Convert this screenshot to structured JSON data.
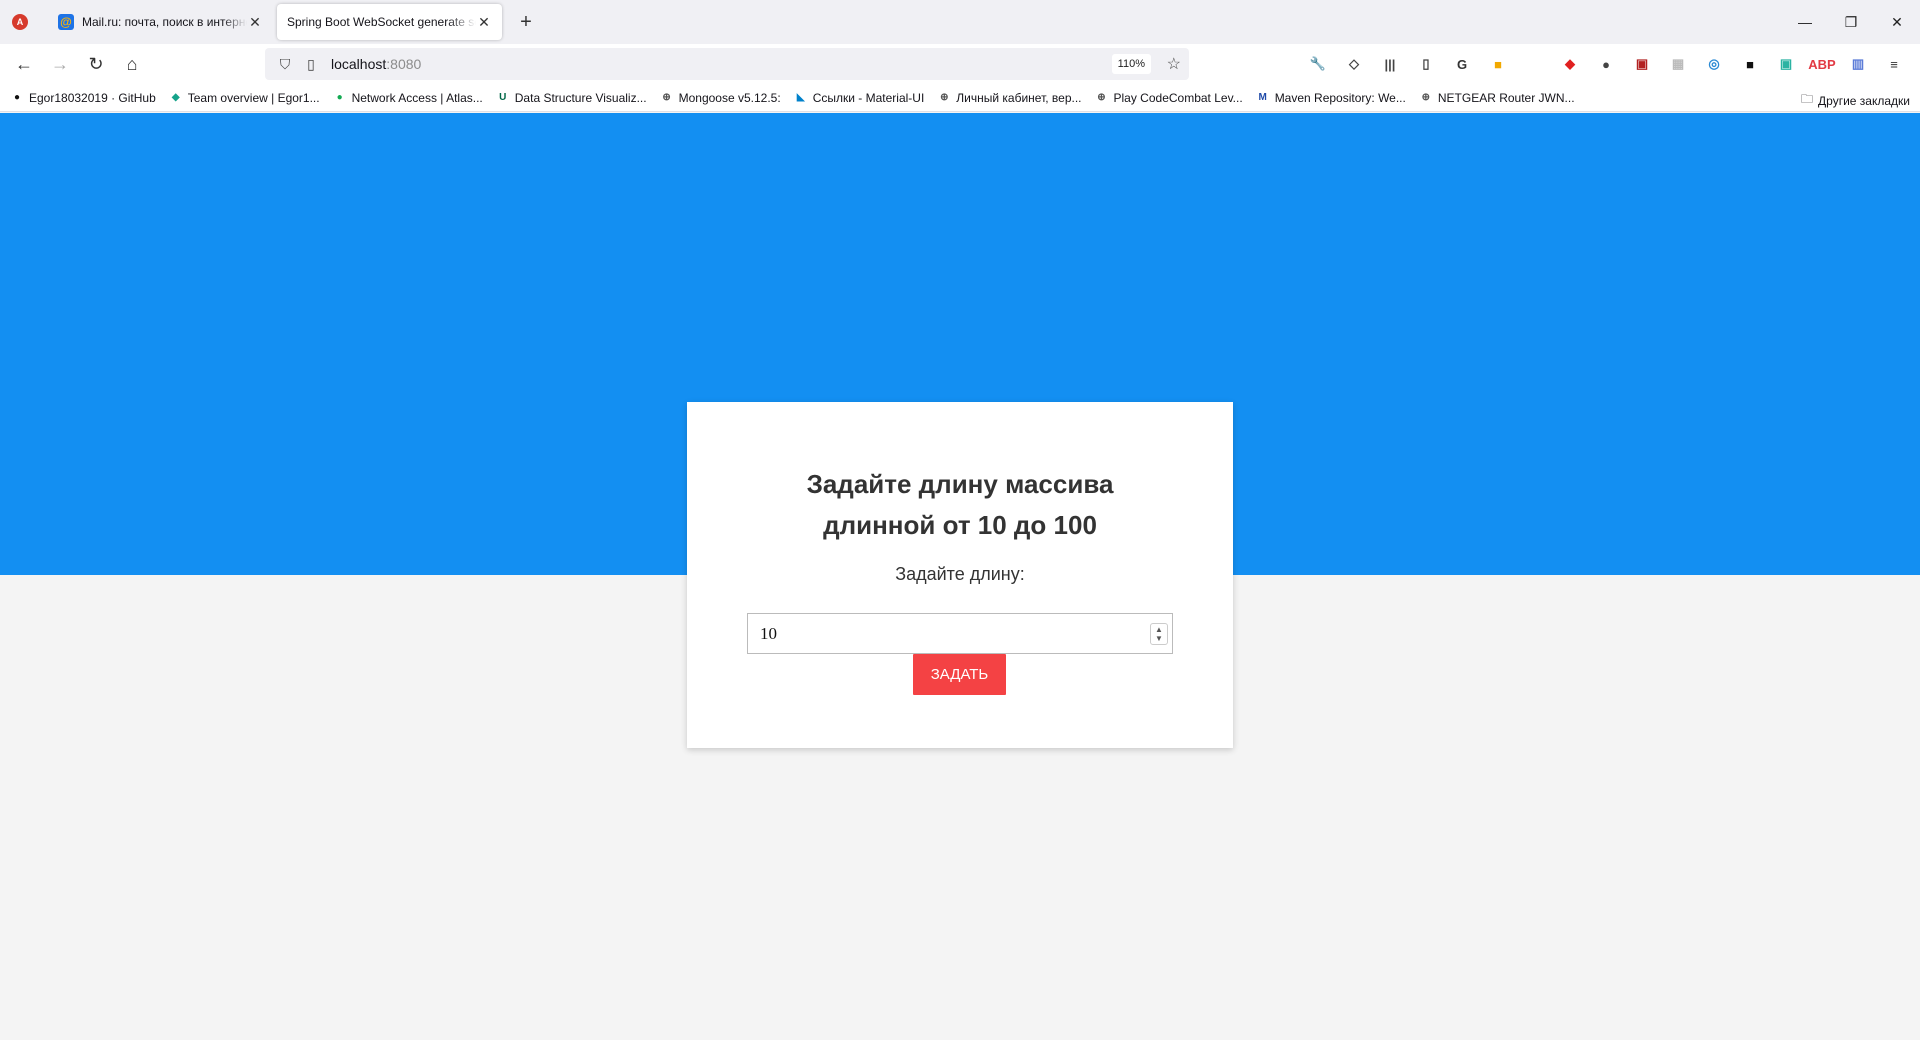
{
  "tabs": [
    {
      "title": "Mail.ru: почта, поиск в интернете"
    },
    {
      "title": "Spring Boot WebSocket generate sequence"
    }
  ],
  "url": {
    "host": "localhost",
    "port": ":8080",
    "zoom": "110%"
  },
  "bookmarks": [
    {
      "label": "Egor18032019 · GitHub",
      "icon": "github-icon",
      "color": "#111111"
    },
    {
      "label": "Team overview | Egor1...",
      "icon": "diamond-icon",
      "color": "#15a38a"
    },
    {
      "label": "Network Access | Atlas...",
      "icon": "mongodb-leaf-icon",
      "color": "#13aa52"
    },
    {
      "label": "Data Structure Visualiz...",
      "icon": "usf-icon",
      "color": "#006747"
    },
    {
      "label": "Mongoose v5.12.5:",
      "icon": "globe-icon",
      "color": "#555555"
    },
    {
      "label": "Ссылки - Material-UI",
      "icon": "material-ui-icon",
      "color": "#0081cb"
    },
    {
      "label": "Личный кабинет, вер...",
      "icon": "globe-icon",
      "color": "#555555"
    },
    {
      "label": "Play CodeCombat Lev...",
      "icon": "globe-icon",
      "color": "#555555"
    },
    {
      "label": "Maven Repository: We...",
      "icon": "mvn-icon",
      "color": "#1f4aa8"
    },
    {
      "label": "NETGEAR Router JWN...",
      "icon": "globe-icon",
      "color": "#555555"
    }
  ],
  "other_bookmarks": "Другие закладки",
  "extensions": [
    {
      "name": "wrench-icon",
      "color": "#444444",
      "glyph": "🔧"
    },
    {
      "name": "pocket-icon",
      "color": "#444444",
      "glyph": "◇"
    },
    {
      "name": "library-icon",
      "color": "#444444",
      "glyph": "|||"
    },
    {
      "name": "sidebar-icon",
      "color": "#444444",
      "glyph": "▯"
    },
    {
      "name": "grammarly-g-icon",
      "color": "#333333",
      "glyph": "G"
    },
    {
      "name": "bookmark-flag-icon",
      "color": "#f2a900",
      "glyph": "■"
    },
    {
      "name": "gradient-square-icon",
      "color": "#e8589a",
      "glyph": ""
    },
    {
      "name": "shield-red-icon",
      "color": "#e02020",
      "glyph": "◆"
    },
    {
      "name": "people-icon",
      "color": "#444444",
      "glyph": "●"
    },
    {
      "name": "screenshot-icon",
      "color": "#b22222",
      "glyph": "▣"
    },
    {
      "name": "grid-icon",
      "color": "#bbbbbb",
      "glyph": "▦"
    },
    {
      "name": "circle-o-icon",
      "color": "#2a8ad4",
      "glyph": "◎"
    },
    {
      "name": "save-icon",
      "color": "#111111",
      "glyph": "■"
    },
    {
      "name": "teal-box-icon",
      "color": "#2bb3a3",
      "glyph": "▣"
    },
    {
      "name": "adblock-abp-icon",
      "color": "#e23a44",
      "glyph": "ABP"
    },
    {
      "name": "map-icon",
      "color": "#5b7bd8",
      "glyph": "▥"
    },
    {
      "name": "menu-icon",
      "color": "#333333",
      "glyph": "≡"
    }
  ],
  "card": {
    "heading": "Задайте длину массива длинной от 10 до 100",
    "label": "Задайте длину:",
    "input_value": "10",
    "submit_label": "ЗАДАТЬ"
  },
  "colors": {
    "hero": "#138ff2",
    "submit": "#f44244",
    "background": "#f4f4f4"
  }
}
